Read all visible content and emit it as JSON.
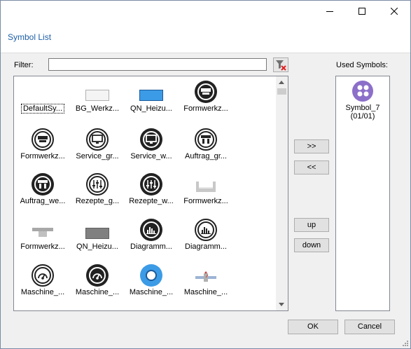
{
  "window": {
    "title": "Symbol List"
  },
  "filter": {
    "label": "Filter:",
    "value": ""
  },
  "used_symbols": {
    "label": "Used Symbols:",
    "items": [
      {
        "name": "Symbol_7",
        "count": "(01/01)",
        "icon": "purple-dots-circle-icon",
        "color": "#8c6fc9"
      }
    ]
  },
  "buttons": {
    "add": ">>",
    "remove": "<<",
    "up": "up",
    "down": "down",
    "ok": "OK",
    "cancel": "Cancel"
  },
  "symbols": [
    {
      "label": "DefaultSy...",
      "icon": "empty",
      "selected": true
    },
    {
      "label": "BG_Werkz...",
      "icon": "light-gray-rectangle-icon"
    },
    {
      "label": "QN_Heizu...",
      "icon": "blue-rectangle-icon",
      "color": "#3c9be6"
    },
    {
      "label": "Formwerkz...",
      "icon": "mold-circle-icon"
    },
    {
      "label": "Formwerkz...",
      "icon": "mold-outline-circle-icon"
    },
    {
      "label": "Service_gr...",
      "icon": "monitor-outline-circle-icon"
    },
    {
      "label": "Service_w...",
      "icon": "monitor-circle-icon"
    },
    {
      "label": "Auftrag_gr...",
      "icon": "job-outline-circle-icon"
    },
    {
      "label": "Auftrag_we...",
      "icon": "job-circle-icon"
    },
    {
      "label": "Rezepte_g...",
      "icon": "sliders-outline-circle-icon"
    },
    {
      "label": "Rezepte_w...",
      "icon": "sliders-circle-icon"
    },
    {
      "label": "Formwerkz...",
      "icon": "gray-tray-icon"
    },
    {
      "label": "Formwerkz...",
      "icon": "gray-t-shape-icon"
    },
    {
      "label": "QN_Heizu...",
      "icon": "gray-rectangle-icon"
    },
    {
      "label": "Diagramm...",
      "icon": "bar-chart-circle-icon"
    },
    {
      "label": "Diagramm...",
      "icon": "bar-chart-outline-circle-icon"
    },
    {
      "label": "Maschine_...",
      "icon": "gauge-outline-circle-icon"
    },
    {
      "label": "Maschine_...",
      "icon": "gauge-circle-icon"
    },
    {
      "label": "Maschine_...",
      "icon": "blue-ring-icon",
      "color": "#3c9be6"
    },
    {
      "label": "Maschine_...",
      "icon": "heating-band-icon"
    }
  ]
}
